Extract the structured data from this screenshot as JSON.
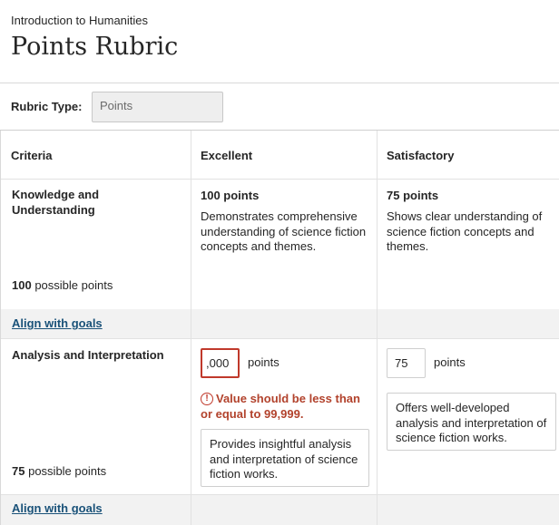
{
  "header": {
    "course": "Introduction to Humanities",
    "title": "Points Rubric"
  },
  "rubric_type": {
    "label": "Rubric Type:",
    "value": "Points"
  },
  "columns": {
    "criteria": "Criteria",
    "excellent": "Excellent",
    "satisfactory": "Satisfactory"
  },
  "rows": [
    {
      "criterion": "Knowledge and Understanding",
      "possible_value": "100",
      "possible_suffix": "possible points",
      "excellent_points": "100 points",
      "excellent_desc": "Demonstrates comprehensive understanding of science fiction concepts and themes.",
      "satisfactory_points": "75 points",
      "satisfactory_desc": "Shows clear understanding of science fiction concepts and themes.",
      "align_link": "Align with goals"
    },
    {
      "criterion": "Analysis and Interpretation",
      "possible_value": "75",
      "possible_suffix": "possible points",
      "excellent_input": ",000",
      "excellent_unit": "points",
      "error_message": "Value should be less than or equal to 99,999.",
      "excellent_desc": "Provides insightful analysis and interpretation of science fiction works.",
      "satisfactory_input": "75",
      "satisfactory_unit": "points",
      "satisfactory_desc": "Offers well-developed analysis and interpretation of science fiction works.",
      "align_link": "Align with goals"
    }
  ],
  "colors": {
    "error": "#c0392b",
    "link": "#1a5279",
    "band": "#f2f2f2"
  },
  "icons": {
    "error": "exclamation-circle-icon"
  }
}
